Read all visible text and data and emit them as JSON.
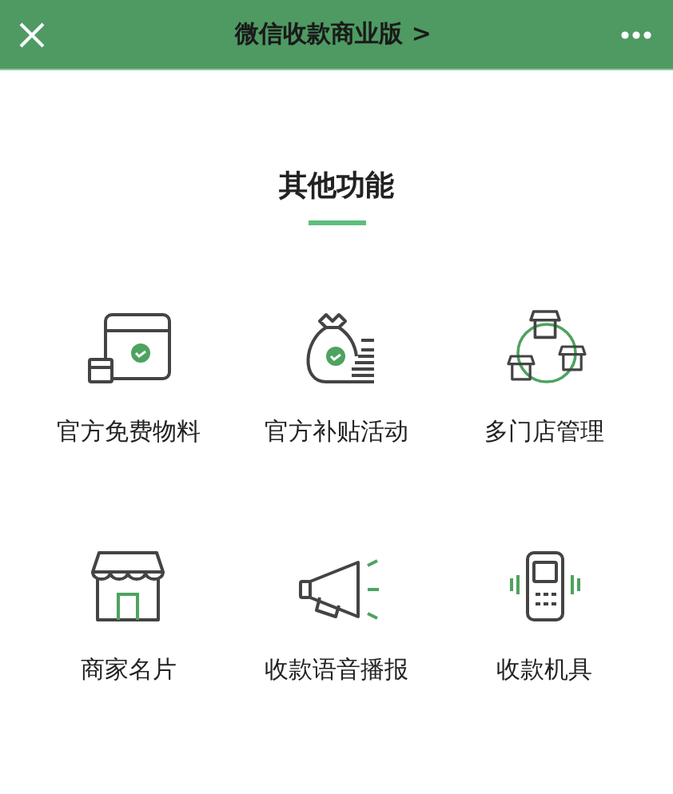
{
  "header": {
    "title": "微信收款商业版 >"
  },
  "section": {
    "title": "其他功能"
  },
  "features": [
    {
      "kind": "materials",
      "label": "官方免费物料"
    },
    {
      "kind": "subsidy",
      "label": "官方补贴活动"
    },
    {
      "kind": "stores",
      "label": "多门店管理"
    },
    {
      "kind": "shop",
      "label": "商家名片"
    },
    {
      "kind": "speaker",
      "label": "收款语音播报"
    },
    {
      "kind": "device",
      "label": "收款机具"
    }
  ]
}
